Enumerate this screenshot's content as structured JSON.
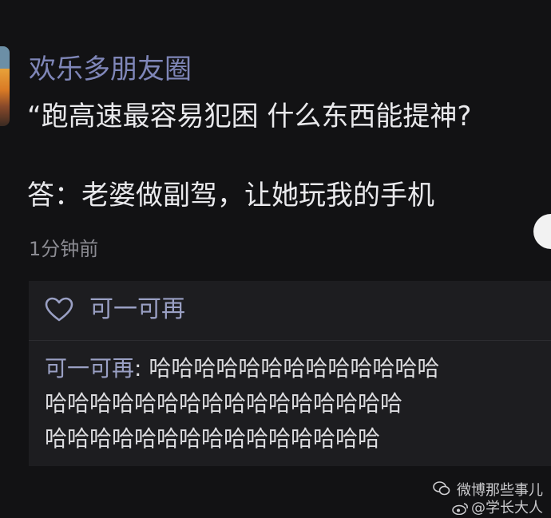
{
  "post": {
    "username": "欢乐多朋友圈",
    "line1": "“跑高速最容易犯困 什么东西能提神?",
    "line2": "答：老婆做副驾，让她玩我的手机",
    "timestamp": "1分钟前"
  },
  "likes": {
    "icon": "heart-outline-icon",
    "names": "可一可再"
  },
  "comment": {
    "author": "可一可再",
    "separator": ": ",
    "line1": "哈哈哈哈哈哈哈哈哈哈哈哈哈",
    "line2": "哈哈哈哈哈哈哈哈哈哈哈哈哈哈哈哈",
    "line3": "哈哈哈哈哈哈哈哈哈哈哈哈哈哈哈"
  },
  "watermark": {
    "line1": "微博那些事儿",
    "line2": "@学长大人"
  },
  "colors": {
    "background": "#121214",
    "username": "#7f86b8",
    "text": "#e9e9ec",
    "muted": "#8b8b92",
    "panel": "#1d1d20"
  }
}
